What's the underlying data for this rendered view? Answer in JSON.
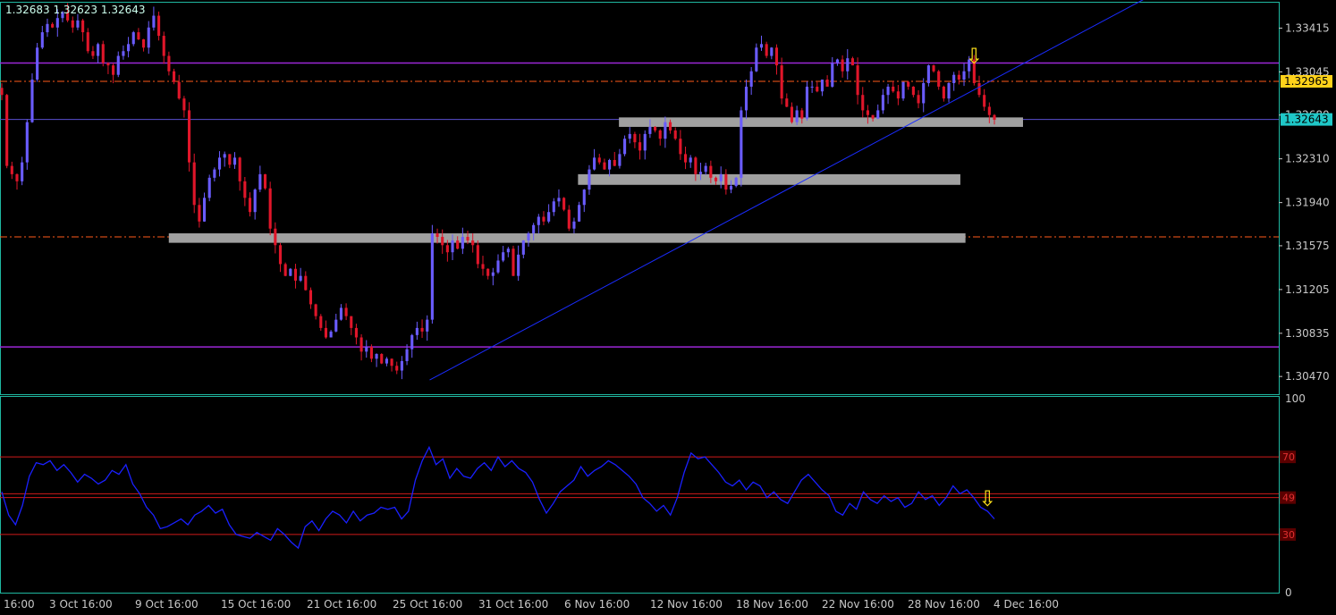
{
  "ohlc_readout": "1.32683 1.32623 1.32643",
  "colors": {
    "background": "#000000",
    "frame": "#1fb8a0",
    "bull": "#6a5cff",
    "bear": "#e0162a",
    "resistance_line": "#9b27d6",
    "dashed_level": "#ff5a1a",
    "price_tag": "#ffd21a",
    "current_tag": "#1fc8c8",
    "zone": "#a0a0a0",
    "trendline": "#1a2cff",
    "indicator_line": "#1a20ff",
    "indicator_levels": "#d01a1a",
    "arrow": "#ffe21a",
    "axis_text": "#c8c8c8"
  },
  "icons": [
    "down-arrow-signal-icon",
    "down-arrow-signal-icon"
  ],
  "chart_data": [
    {
      "type": "candlestick",
      "y_ticks": [
        "1.33415",
        "1.33045",
        "1.32680",
        "1.32310",
        "1.31940",
        "1.31575",
        "1.31205",
        "1.30835",
        "1.30470"
      ],
      "ylim": [
        1.3032,
        1.3363
      ],
      "x_labels": [
        "16:00",
        "3 Oct 16:00",
        "9 Oct 16:00",
        "15 Oct 16:00",
        "21 Oct 16:00",
        "25 Oct 16:00",
        "31 Oct 16:00",
        "6 Nov 16:00",
        "12 Nov 16:00",
        "18 Nov 16:00",
        "22 Nov 16:00",
        "28 Nov 16:00",
        "4 Dec 16:00"
      ],
      "price_tags": [
        {
          "label": "1.32965",
          "value": 1.32965,
          "kind": "level"
        },
        {
          "label": "1.32643",
          "value": 1.32643,
          "kind": "current"
        }
      ],
      "horizontal_levels": [
        {
          "value": 1.3312,
          "style": "solid"
        },
        {
          "value": 1.3072,
          "style": "solid"
        },
        {
          "value": 1.32965,
          "style": "dashdot"
        },
        {
          "value": 1.3165,
          "style": "dashdot"
        },
        {
          "value": 1.32643,
          "style": "solid-thin"
        }
      ],
      "zones": [
        {
          "y_top": 1.3266,
          "y_bottom": 1.3258,
          "x_from": 0.484,
          "x_to": 0.8
        },
        {
          "y_top": 1.3218,
          "y_bottom": 1.3209,
          "x_from": 0.452,
          "x_to": 0.751
        },
        {
          "y_top": 1.3168,
          "y_bottom": 1.316,
          "x_from": 0.132,
          "x_to": 0.755
        }
      ],
      "trendline": {
        "from": [
          0.336,
          1.3044
        ],
        "to": [
          0.9,
          1.3369
        ]
      },
      "closes": [
        1.3285,
        1.3225,
        1.3218,
        1.3212,
        1.3228,
        1.3262,
        1.3298,
        1.3325,
        1.3338,
        1.3345,
        1.3342,
        1.335,
        1.3355,
        1.3348,
        1.3342,
        1.3348,
        1.3338,
        1.3322,
        1.3318,
        1.3328,
        1.3312,
        1.331,
        1.3302,
        1.3318,
        1.3322,
        1.3328,
        1.3338,
        1.3332,
        1.3325,
        1.3342,
        1.3352,
        1.3335,
        1.3318,
        1.3305,
        1.3296,
        1.3282,
        1.3272,
        1.3228,
        1.3192,
        1.3178,
        1.3198,
        1.3215,
        1.3222,
        1.3232,
        1.3235,
        1.3226,
        1.3232,
        1.3212,
        1.3198,
        1.3186,
        1.3205,
        1.3218,
        1.3206,
        1.3172,
        1.3158,
        1.3142,
        1.3132,
        1.3138,
        1.3128,
        1.3132,
        1.312,
        1.3108,
        1.3098,
        1.3088,
        1.308,
        1.3085,
        1.3095,
        1.3105,
        1.3098,
        1.3088,
        1.308,
        1.3068,
        1.3072,
        1.3062,
        1.3066,
        1.3058,
        1.3062,
        1.3056,
        1.3052,
        1.306,
        1.307,
        1.3082,
        1.3088,
        1.3085,
        1.3095,
        1.3168,
        1.3165,
        1.3158,
        1.3152,
        1.3162,
        1.3155,
        1.3165,
        1.3162,
        1.3158,
        1.3142,
        1.3138,
        1.3132,
        1.3135,
        1.3145,
        1.3152,
        1.3155,
        1.3132,
        1.315,
        1.3162,
        1.3168,
        1.3175,
        1.3182,
        1.3178,
        1.3186,
        1.3195,
        1.3198,
        1.3188,
        1.3172,
        1.3178,
        1.3192,
        1.3205,
        1.3222,
        1.3232,
        1.3228,
        1.3222,
        1.323,
        1.3225,
        1.3235,
        1.3248,
        1.3252,
        1.3245,
        1.3238,
        1.3252,
        1.3258,
        1.3255,
        1.3248,
        1.3262,
        1.3255,
        1.3248,
        1.3235,
        1.3228,
        1.3232,
        1.3218,
        1.322,
        1.3225,
        1.3215,
        1.3212,
        1.3218,
        1.3205,
        1.3208,
        1.3215,
        1.3272,
        1.3292,
        1.3305,
        1.3325,
        1.3328,
        1.3318,
        1.3325,
        1.331,
        1.3282,
        1.3275,
        1.3262,
        1.3272,
        1.3265,
        1.3292,
        1.3292,
        1.3288,
        1.3298,
        1.3292,
        1.3312,
        1.3315,
        1.3305,
        1.3316,
        1.331,
        1.3285,
        1.3272,
        1.3268,
        1.3265,
        1.3272,
        1.3285,
        1.3292,
        1.3288,
        1.3282,
        1.3296,
        1.3292,
        1.3285,
        1.3278,
        1.3295,
        1.331,
        1.3305,
        1.3292,
        1.3282,
        1.3295,
        1.3302,
        1.3298,
        1.3305,
        1.3315,
        1.3295,
        1.3285,
        1.3275,
        1.3268,
        1.3264
      ],
      "volatility": 0.0008
    },
    {
      "type": "line",
      "y_ticks": [
        "100",
        "70",
        "49",
        "30",
        "0"
      ],
      "ylim": [
        0,
        100
      ],
      "levels": [
        70,
        51,
        49,
        30
      ],
      "values": [
        52,
        40,
        35,
        45,
        60,
        67,
        66,
        68,
        63,
        66,
        62,
        57,
        61,
        59,
        56,
        58,
        63,
        61,
        66,
        56,
        51,
        44,
        40,
        33,
        34,
        36,
        38,
        35,
        40,
        42,
        45,
        41,
        43,
        35,
        30,
        29,
        28,
        31,
        29,
        27,
        33,
        30,
        26,
        23,
        34,
        37,
        32,
        38,
        42,
        40,
        36,
        42,
        37,
        40,
        41,
        44,
        43,
        44,
        38,
        42,
        58,
        68,
        75,
        66,
        69,
        59,
        64,
        60,
        59,
        64,
        67,
        63,
        70,
        65,
        68,
        64,
        62,
        57,
        48,
        41,
        46,
        52,
        55,
        58,
        65,
        60,
        63,
        65,
        68,
        66,
        63,
        60,
        56,
        49,
        46,
        42,
        45,
        40,
        49,
        62,
        72,
        69,
        70,
        66,
        62,
        57,
        55,
        58,
        53,
        57,
        55,
        49,
        52,
        48,
        46,
        52,
        58,
        61,
        57,
        53,
        50,
        42,
        40,
        46,
        43,
        52,
        48,
        46,
        50,
        47,
        49,
        44,
        46,
        52,
        48,
        50,
        45,
        49,
        55,
        51,
        53,
        49,
        44,
        42,
        38
      ],
      "arrow": {
        "index": 143,
        "label": "⇩"
      }
    }
  ]
}
